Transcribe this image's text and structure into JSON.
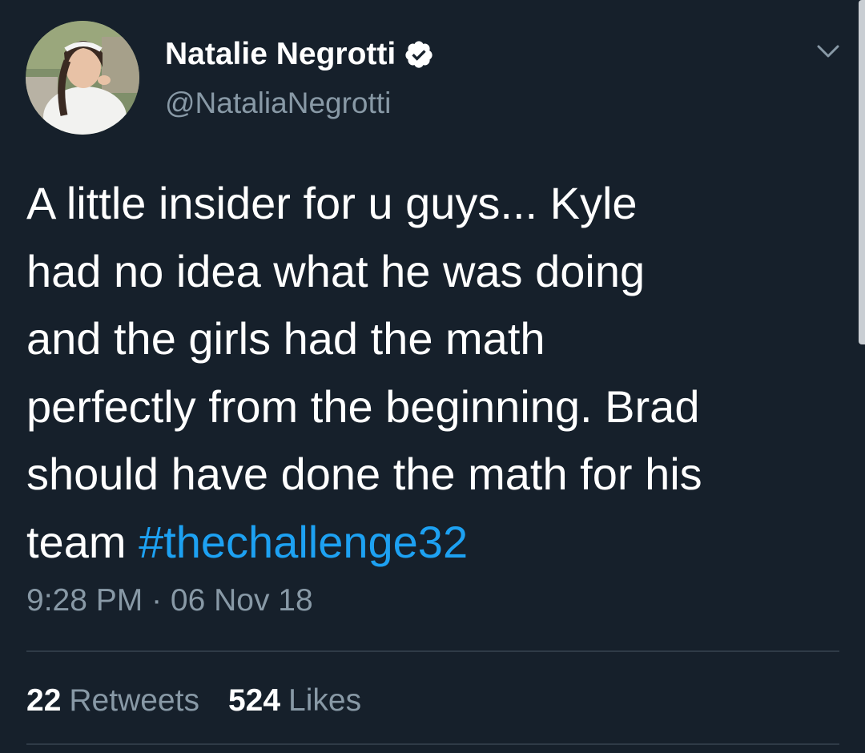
{
  "tweet": {
    "author": {
      "display_name": "Natalie Negrotti",
      "handle": "@NataliaNegrotti",
      "verified": true
    },
    "text_lines": [
      "A little insider for u guys... Kyle",
      "had no idea what he was doing",
      "and the girls had the math",
      "perfectly from the beginning. Brad",
      "should have done the math for his",
      "team "
    ],
    "hashtag": "#thechallenge32",
    "timestamp": "9:28 PM · 06 Nov 18",
    "retweets_count": "22",
    "retweets_label": "Retweets",
    "likes_count": "524",
    "likes_label": "Likes"
  },
  "icons": {
    "verified": "verified-badge-icon",
    "menu": "chevron-down-icon"
  },
  "colors": {
    "background": "#16202b",
    "text": "#ffffff",
    "secondary_text": "#8899a6",
    "link": "#1da1f2",
    "divider": "#2f3b47"
  }
}
